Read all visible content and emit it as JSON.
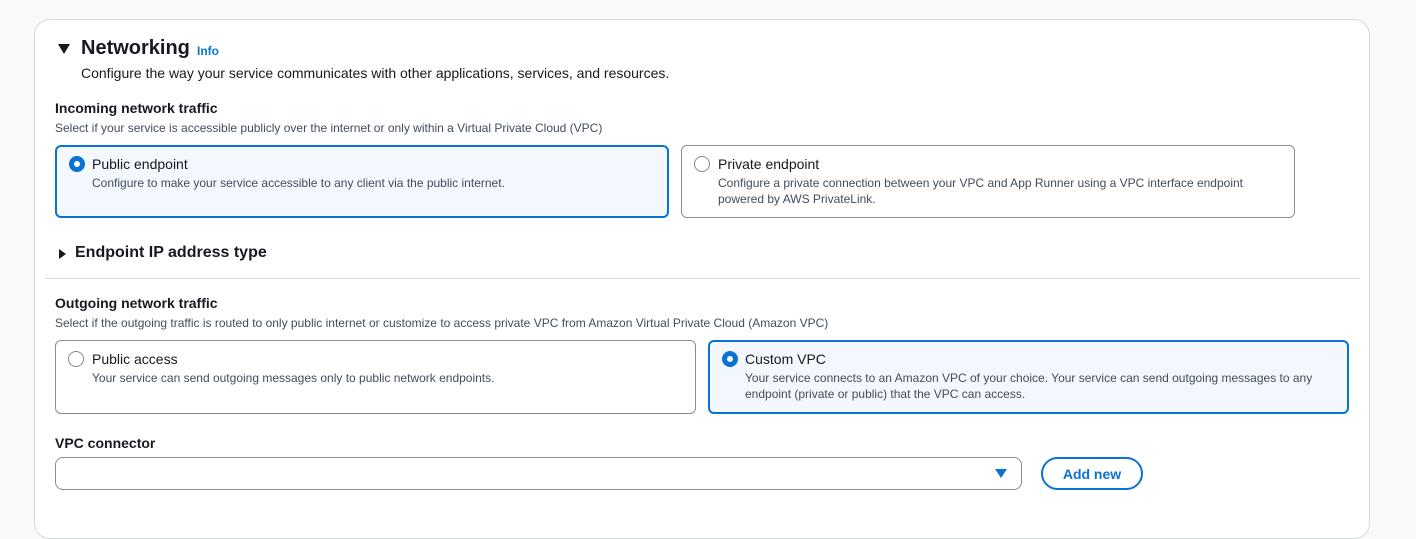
{
  "networking": {
    "title": "Networking",
    "info_label": "Info",
    "description": "Configure the way your service communicates with other applications, services, and resources."
  },
  "incoming": {
    "label": "Incoming network traffic",
    "hint": "Select if your service is accessible publicly over the internet or only within a Virtual Private Cloud (VPC)",
    "options": [
      {
        "title": "Public endpoint",
        "description": "Configure to make your service accessible to any client via the public internet.",
        "selected": true
      },
      {
        "title": "Private endpoint",
        "description": "Configure a private connection between your VPC and App Runner using a VPC interface endpoint powered by AWS PrivateLink.",
        "selected": false
      }
    ]
  },
  "endpoint_ip": {
    "title": "Endpoint IP address type"
  },
  "outgoing": {
    "label": "Outgoing network traffic",
    "hint": "Select if the outgoing traffic is routed to only public internet or customize to access private VPC from Amazon Virtual Private Cloud (Amazon VPC)",
    "options": [
      {
        "title": "Public access",
        "description": "Your service can send outgoing messages only to public network endpoints.",
        "selected": false
      },
      {
        "title": "Custom VPC",
        "description": "Your service connects to an Amazon VPC of your choice. Your service can send outgoing messages to any endpoint (private or public) that the VPC can access.",
        "selected": true
      }
    ]
  },
  "vpc_connector": {
    "label": "VPC connector",
    "value": "",
    "add_new_label": "Add new"
  },
  "colors": {
    "accent": "#0972d3",
    "selected_bg": "#f2f8fd",
    "border": "#8c8c94",
    "text": "#16191f",
    "muted": "#414d5c"
  },
  "icons": {
    "section_toggle": "caret-down-icon",
    "collapsed_toggle": "caret-right-icon",
    "select_dropdown": "triangle-down-icon"
  }
}
